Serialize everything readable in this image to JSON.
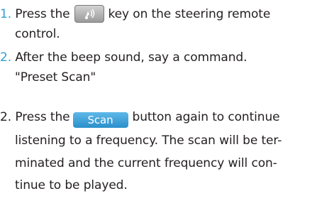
{
  "steps": [
    {
      "num": "1.",
      "text_before": "Press the",
      "key_icon": "voice-recognition-icon",
      "text_after": "key on the steering remote",
      "continuation": "control."
    },
    {
      "num": "2.",
      "text": "After the beep sound, say a command.",
      "command": "\"Preset Scan\""
    }
  ],
  "step3": {
    "num": "2.",
    "text_before": "Press the",
    "button_label": "Scan",
    "text_after": "button again to continue",
    "lines": [
      "listening to a frequency. The scan will be ter-",
      "minated and the current frequency will con-",
      "tinue to be played."
    ]
  },
  "colors": {
    "step_number": "#2e9fd6",
    "text": "#231f20",
    "scan_button": "#3a9fd8"
  }
}
